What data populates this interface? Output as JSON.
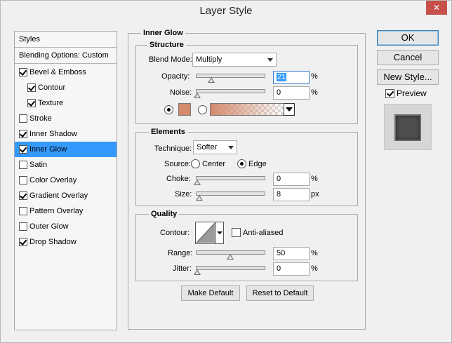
{
  "window": {
    "title": "Layer Style",
    "close": "✕"
  },
  "sidebar": {
    "header": "Styles",
    "blending": "Blending Options: Custom",
    "items": [
      {
        "label": "Bevel & Emboss",
        "checked": true,
        "indent": false,
        "selected": false
      },
      {
        "label": "Contour",
        "checked": true,
        "indent": true,
        "selected": false
      },
      {
        "label": "Texture",
        "checked": true,
        "indent": true,
        "selected": false
      },
      {
        "label": "Stroke",
        "checked": false,
        "indent": false,
        "selected": false
      },
      {
        "label": "Inner Shadow",
        "checked": true,
        "indent": false,
        "selected": false
      },
      {
        "label": "Inner Glow",
        "checked": true,
        "indent": false,
        "selected": true
      },
      {
        "label": "Satin",
        "checked": false,
        "indent": false,
        "selected": false
      },
      {
        "label": "Color Overlay",
        "checked": false,
        "indent": false,
        "selected": false
      },
      {
        "label": "Gradient Overlay",
        "checked": true,
        "indent": false,
        "selected": false
      },
      {
        "label": "Pattern Overlay",
        "checked": false,
        "indent": false,
        "selected": false
      },
      {
        "label": "Outer Glow",
        "checked": false,
        "indent": false,
        "selected": false
      },
      {
        "label": "Drop Shadow",
        "checked": true,
        "indent": false,
        "selected": false
      }
    ]
  },
  "panel": {
    "title": "Inner Glow",
    "structure": {
      "title": "Structure",
      "blend_mode_label": "Blend Mode:",
      "blend_mode": "Multiply",
      "opacity_label": "Opacity:",
      "opacity": "21",
      "opacity_unit": "%",
      "opacity_level": 21,
      "noise_label": "Noise:",
      "noise": "0",
      "noise_unit": "%",
      "noise_level": 0,
      "glow_color": "#d48a6c",
      "gradient_color": "#d48a6c"
    },
    "elements": {
      "title": "Elements",
      "technique_label": "Technique:",
      "technique": "Softer",
      "source_label": "Source:",
      "source_center": "Center",
      "source_edge": "Edge",
      "choke_label": "Choke:",
      "choke": "0",
      "choke_unit": "%",
      "choke_level": 0,
      "size_label": "Size:",
      "size": "8",
      "size_unit": "px",
      "size_level": 3
    },
    "quality": {
      "title": "Quality",
      "contour_label": "Contour:",
      "antialiased_label": "Anti-aliased",
      "range_label": "Range:",
      "range": "50",
      "range_unit": "%",
      "range_level": 50,
      "jitter_label": "Jitter:",
      "jitter": "0",
      "jitter_unit": "%",
      "jitter_level": 0
    },
    "make_default": "Make Default",
    "reset_default": "Reset to Default"
  },
  "actions": {
    "ok": "OK",
    "cancel": "Cancel",
    "new_style": "New Style...",
    "preview": "Preview"
  }
}
